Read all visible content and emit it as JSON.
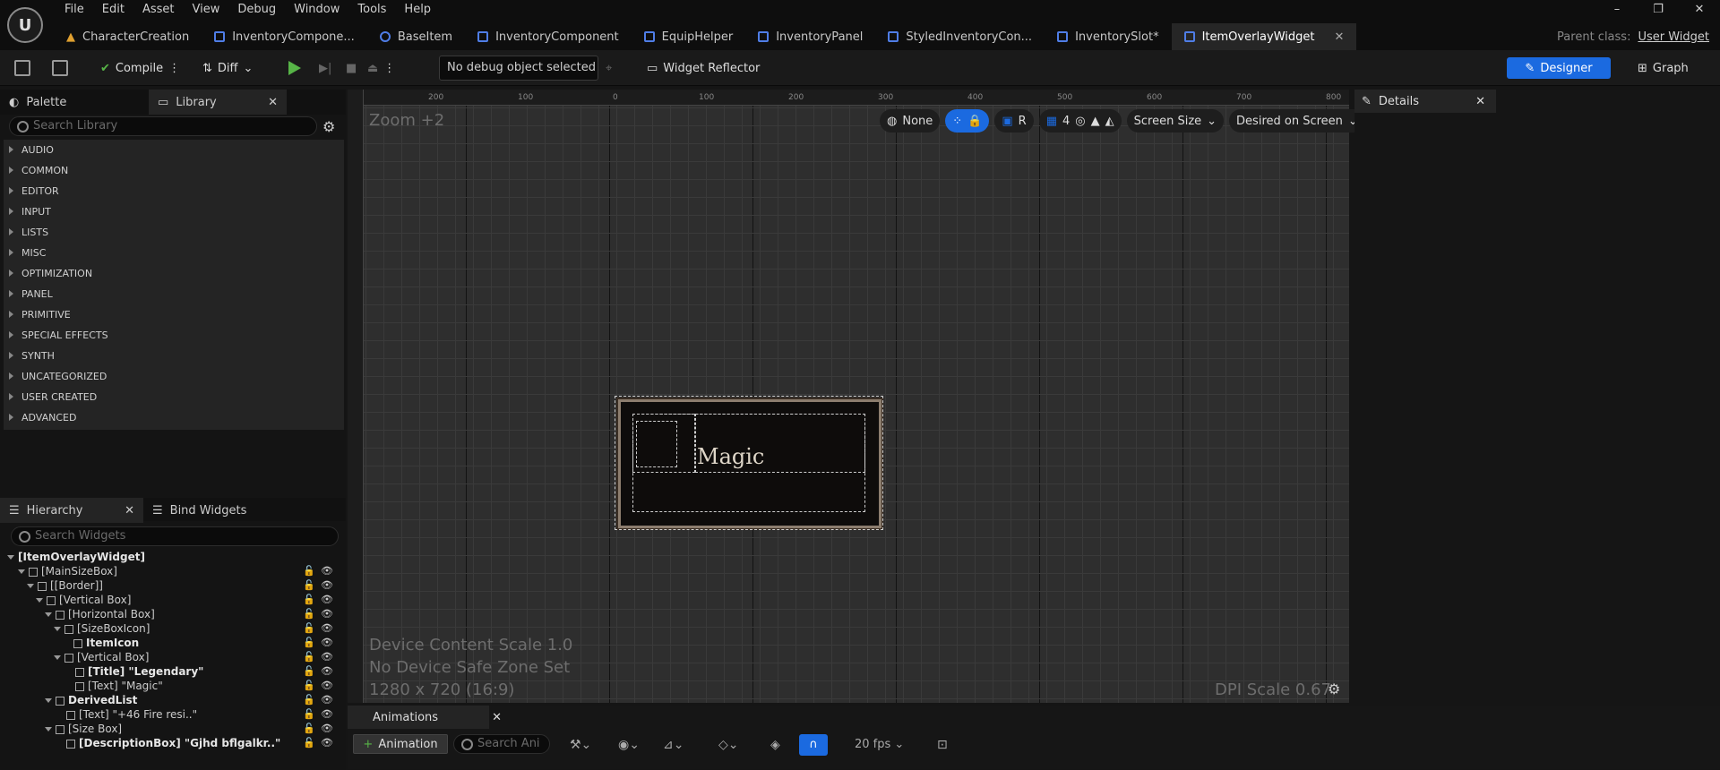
{
  "menu": [
    "File",
    "Edit",
    "Asset",
    "View",
    "Debug",
    "Window",
    "Tools",
    "Help"
  ],
  "window_controls": [
    "–",
    "❐",
    "✕"
  ],
  "tabs": [
    {
      "label": "CharacterCreation",
      "icon": "warning-icon"
    },
    {
      "label": "InventoryCompone...",
      "icon": "widget-icon"
    },
    {
      "label": "BaseItem",
      "icon": "blueprint-icon"
    },
    {
      "label": "InventoryComponent",
      "icon": "widget-icon"
    },
    {
      "label": "EquipHelper",
      "icon": "function-icon"
    },
    {
      "label": "InventoryPanel",
      "icon": "widget-icon"
    },
    {
      "label": "StyledInventoryCon...",
      "icon": "widget-icon"
    },
    {
      "label": "InventorySlot*",
      "icon": "widget-icon"
    },
    {
      "label": "ItemOverlayWidget",
      "icon": "widget-icon",
      "close": "✕"
    }
  ],
  "parent_class": {
    "label": "Parent class:",
    "value": "User Widget"
  },
  "toolbar": {
    "compile": "Compile",
    "diff": "Diff",
    "debug_object": "No debug object selected",
    "widget_reflector": "Widget Reflector",
    "designer": "Designer",
    "graph": "Graph"
  },
  "palette": {
    "tab_palette": "Palette",
    "tab_library": "Library",
    "close": "✕",
    "search_placeholder": "Search Library",
    "categories": [
      "AUDIO",
      "COMMON",
      "EDITOR",
      "INPUT",
      "LISTS",
      "MISC",
      "OPTIMIZATION",
      "PANEL",
      "PRIMITIVE",
      "SPECIAL EFFECTS",
      "SYNTH",
      "UNCATEGORIZED",
      "USER CREATED",
      "ADVANCED"
    ]
  },
  "hierarchy": {
    "tab_hierarchy": "Hierarchy",
    "tab_bind": "Bind Widgets",
    "close": "✕",
    "search_placeholder": "Search Widgets",
    "rows": [
      "[ItemOverlayWidget]",
      "[MainSizeBox]",
      "[[Border]]",
      "[Vertical Box]",
      "[Horizontal Box]",
      "[SizeBoxIcon]",
      "ItemIcon",
      "[Vertical Box]",
      "[Title] \"Legendary\"",
      "[Text] \"Magic\"",
      "DerivedList",
      "[Text] \"+46 Fire resi..\"",
      "[Size Box]",
      "[DescriptionBox] \"Gjhd bflgalkr..\""
    ]
  },
  "canvas": {
    "zoom": "Zoom +2",
    "none": "None",
    "r": "R",
    "grid": "4",
    "screen_size": "Screen Size",
    "desired": "Desired on Screen",
    "magic_text": "Magic",
    "device_scale": "Device Content Scale 1.0",
    "safe_zone": "No Device Safe Zone Set",
    "resolution": "1280 x 720 (16:9)",
    "dpi": "DPI Scale 0.67",
    "ruler_top": [
      "200",
      "100",
      "0",
      "100",
      "200",
      "300",
      "400",
      "500",
      "600",
      "700",
      "800"
    ]
  },
  "details": {
    "tab": "Details",
    "close": "✕"
  },
  "animations": {
    "tab": "Animations",
    "close": "✕",
    "add_button": "Animation",
    "search_placeholder": "Search Ani",
    "fps": "20 fps"
  }
}
